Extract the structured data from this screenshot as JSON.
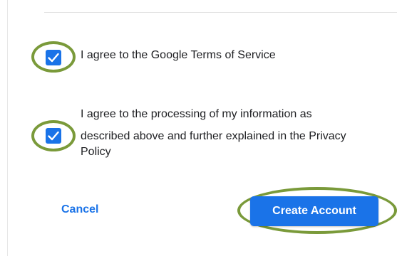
{
  "consent": {
    "terms_label": "I agree to the Google Terms of Service",
    "terms_checked": true,
    "privacy_label_lines": [
      "I agree to the processing of my information as",
      "described above and further explained in the Privacy",
      "Policy"
    ],
    "privacy_checked": true
  },
  "actions": {
    "cancel_label": "Cancel",
    "create_label": "Create Account"
  },
  "colors": {
    "accent": "#1a73e8",
    "checkbox_fill": "#1a73e8",
    "highlight_ring": "#7a9a3a",
    "text": "#202124"
  },
  "icons": {
    "checkmark": "check-icon"
  }
}
